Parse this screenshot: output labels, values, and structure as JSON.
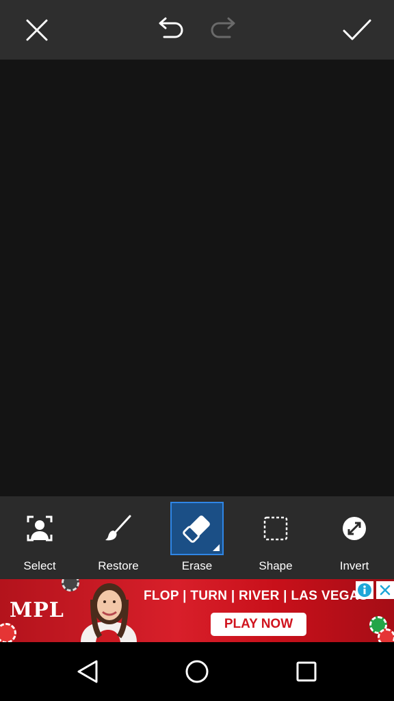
{
  "topbar": {
    "icons": {
      "close": "close-icon",
      "undo": "undo-icon",
      "redo": "redo-icon",
      "apply": "check-icon"
    },
    "redo_enabled": false
  },
  "tools": [
    {
      "label": "Select",
      "icon": "person-select-icon",
      "active": false
    },
    {
      "label": "Restore",
      "icon": "brush-icon",
      "active": false
    },
    {
      "label": "Erase",
      "icon": "eraser-icon",
      "active": true
    },
    {
      "label": "Shape",
      "icon": "dashed-rectangle-icon",
      "active": false
    },
    {
      "label": "Invert",
      "icon": "invert-icon",
      "active": false
    }
  ],
  "ad": {
    "brand": "MPL",
    "headline": "FLOP | TURN | RIVER | LAS VEGAS",
    "cta": "PLAY NOW",
    "icons": {
      "info": "info-icon",
      "close": "close-icon"
    }
  },
  "navbar": {
    "icons": {
      "back": "back-triangle-icon",
      "home": "home-circle-icon",
      "recents": "recents-square-icon"
    }
  },
  "colors": {
    "topbar_bg": "#2e2e2e",
    "canvas_bg": "#141414",
    "toolbar_bg": "#2b2b2b",
    "active_tool_bg": "#1b4f86",
    "active_tool_border": "#2f86e6",
    "ad_red": "#d81f2a",
    "navbar_bg": "#000000"
  }
}
